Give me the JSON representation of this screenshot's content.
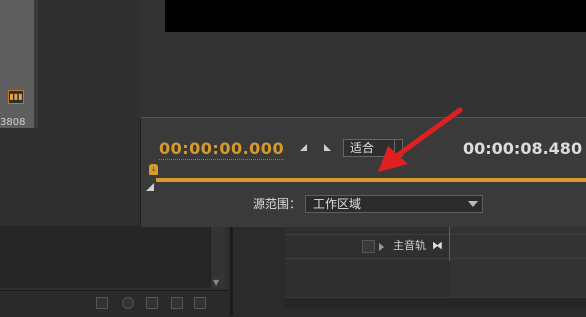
{
  "project_panel": {
    "clip_number_fragment": "3808",
    "audio_icon_name": "audio-waveform-icon",
    "bottom_icons": [
      "list-view-icon",
      "search-icon",
      "folder-icon",
      "new-item-icon",
      "delete-icon"
    ]
  },
  "export_panel": {
    "current_timecode": "00:00:00.000",
    "fit_option": "适合",
    "duration_timecode": "00:00:08.480",
    "source_range_label": "源范围：",
    "source_range_value": "工作区域"
  },
  "timeline": {
    "master_track_label": "主音轨"
  },
  "colors": {
    "accent_orange": "#d89a2a",
    "annotation_red": "#e02020",
    "playhead_red": "#c0392b"
  }
}
